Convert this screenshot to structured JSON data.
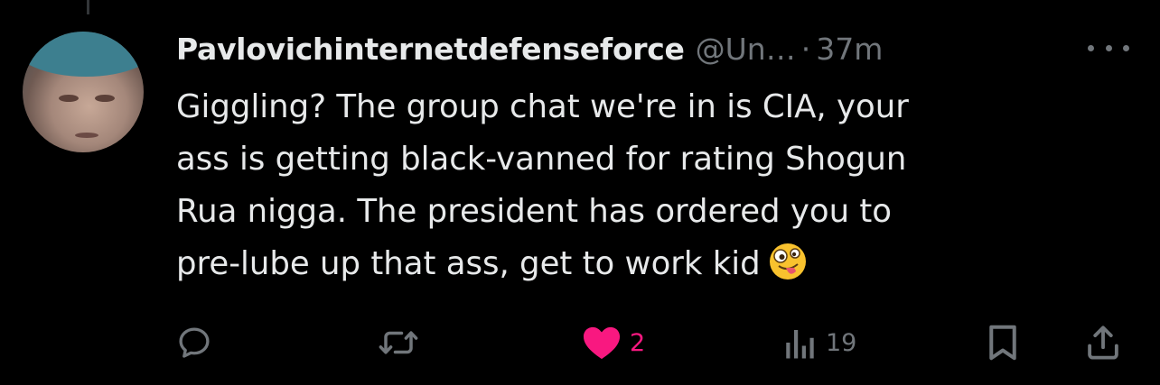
{
  "tweet": {
    "display_name": "Pavlovichinternetdefenseforce",
    "handle": "@Un…",
    "separator": "·",
    "time": "37m",
    "body_lines": [
      "Giggling? The group chat we're in is CIA, your",
      "ass is getting black-vanned for rating Shogun",
      "Rua nigga. The president has ordered you to",
      "pre-lube up that ass, get to work kid"
    ],
    "trailing_emoji": "zany-face-emoji"
  },
  "actions": {
    "reply_icon": "reply-icon",
    "retweet_icon": "retweet-icon",
    "like_icon": "heart-filled-icon",
    "like_count": "2",
    "views_icon": "views-icon",
    "views_count": "19",
    "bookmark_icon": "bookmark-icon",
    "share_icon": "share-icon"
  },
  "colors": {
    "background": "#000000",
    "text_primary": "#e7e9ea",
    "text_secondary": "#71767b",
    "like_active": "#f91880"
  }
}
